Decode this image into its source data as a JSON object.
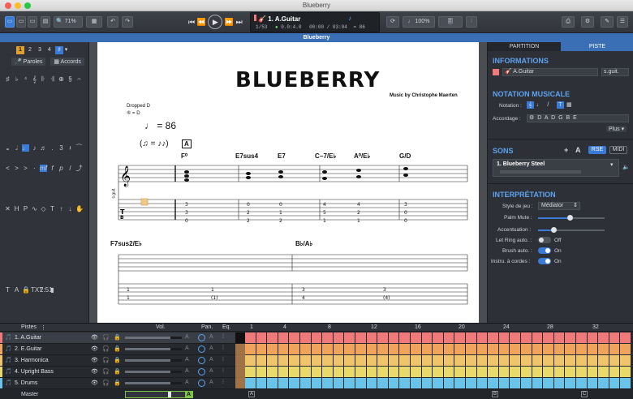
{
  "window": {
    "title": "Blueberry"
  },
  "toolbar": {
    "zoom": "71%",
    "track_name": "1. A.Guitar",
    "bar_position": "1/53",
    "time_sig": "0.0:4.0",
    "time": "00:00 / 03:04",
    "tempo": "= 86",
    "speed": "100%"
  },
  "document": {
    "title": "Blueberry"
  },
  "left_panel": {
    "voices": [
      "1",
      "2",
      "3",
      "4"
    ],
    "lyrics_label": "Paroles",
    "chords_label": "Accords"
  },
  "score": {
    "title": "BLUEBERRY",
    "composer": "Music by Christophe Maerten",
    "tuning_label": "Dropped D",
    "tuning_sub": "⑥ = D",
    "tempo": "♩ = 86",
    "section_marker": "A",
    "instrument_label": "s.guit.",
    "chords_row1": [
      "F⁰",
      "E7sus4",
      "E7",
      "C−7/E♭",
      "A⁰/E♭",
      "G/D"
    ],
    "chords_row2": [
      "F7sus2/E♭",
      "B♭/A♭"
    ],
    "bar_numbers": [
      "2",
      "3",
      "4",
      "5",
      "6",
      "7",
      "8"
    ]
  },
  "right_panel": {
    "tabs": [
      "PARTITION",
      "PISTE"
    ],
    "info_title": "INFORMATIONS",
    "track_name": "A.Guitar",
    "track_short": "s.guit.",
    "notation_title": "NOTATION MUSICALE",
    "notation_label": "Notation :",
    "tuning_label": "Accordage :",
    "tuning_value": "D A D G B E",
    "plus_label": "Plus",
    "sounds_title": "SONS",
    "sound_add": "+",
    "sound_a": "A",
    "rse_label": "RSE",
    "midi_label": "MIDI",
    "sound_name": "1. Blueberry Steel",
    "interp_title": "INTERPRÉTATION",
    "style_label": "Style de jeu :",
    "style_value": "Médiator",
    "palm_label": "Palm Mute :",
    "accent_label": "Accentuation :",
    "letring_label": "Let Ring auto. :",
    "letring_value": "Off",
    "brush_label": "Brush auto. :",
    "brush_value": "On",
    "instru_label": "Instru. à cordes :",
    "instru_value": "On"
  },
  "tracks": {
    "header": "Pistes",
    "vol_label": "Vol.",
    "pan_label": "Pan.",
    "eq_label": "Eq.",
    "bar_markers": [
      "1",
      "4",
      "8",
      "12",
      "16",
      "20",
      "24",
      "28",
      "32"
    ],
    "section_markers": [
      "A",
      "B",
      "C"
    ],
    "items": [
      {
        "name": "1. A.Guitar",
        "color": "#f07a7a",
        "volume": 0.8
      },
      {
        "name": "2. E.Guitar",
        "color": "#f0a35a",
        "volume": 0.8
      },
      {
        "name": "3. Harmonica",
        "color": "#f0c46a",
        "volume": 0.8
      },
      {
        "name": "4. Upright Bass",
        "color": "#e8d96a",
        "volume": 0.8
      },
      {
        "name": "5. Drums",
        "color": "#6ac3e8",
        "volume": 0.8
      }
    ],
    "master_label": "Master"
  }
}
